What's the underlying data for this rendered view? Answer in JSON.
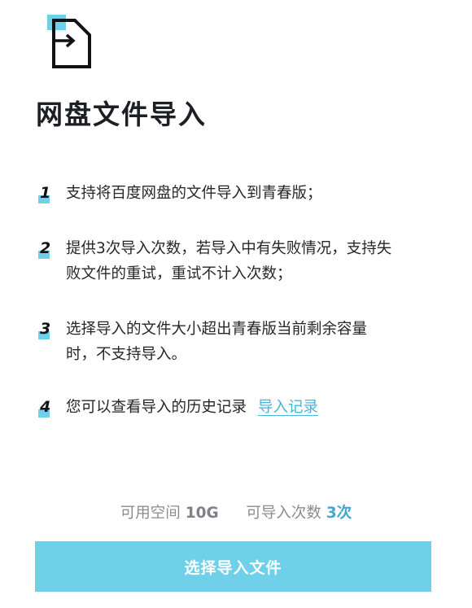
{
  "page": {
    "title": "网盘文件导入"
  },
  "icon": {
    "name": "file-import-icon",
    "accent_color": "#6fd0ea"
  },
  "items": [
    {
      "num": "1",
      "lines": [
        "支持将百度网盘的文件导入到青春版；"
      ]
    },
    {
      "num": "2",
      "lines": [
        "提供3次导入次数，若导入中有失败情况，支持失",
        "败文件的重试，重试不计入次数；"
      ]
    },
    {
      "num": "3",
      "lines": [
        "选择导入的文件大小超出青春版当前剩余容量",
        "时，不支持导入。"
      ]
    },
    {
      "num": "4",
      "lines": [
        "您可以查看导入的历史记录"
      ],
      "link": "导入记录"
    }
  ],
  "quota": {
    "space_label": "可用空间",
    "space_value": "10G",
    "count_label": "可导入次数",
    "count_value": "3次"
  },
  "button": {
    "label": "选择导入文件",
    "color": "#6fd0ea"
  }
}
